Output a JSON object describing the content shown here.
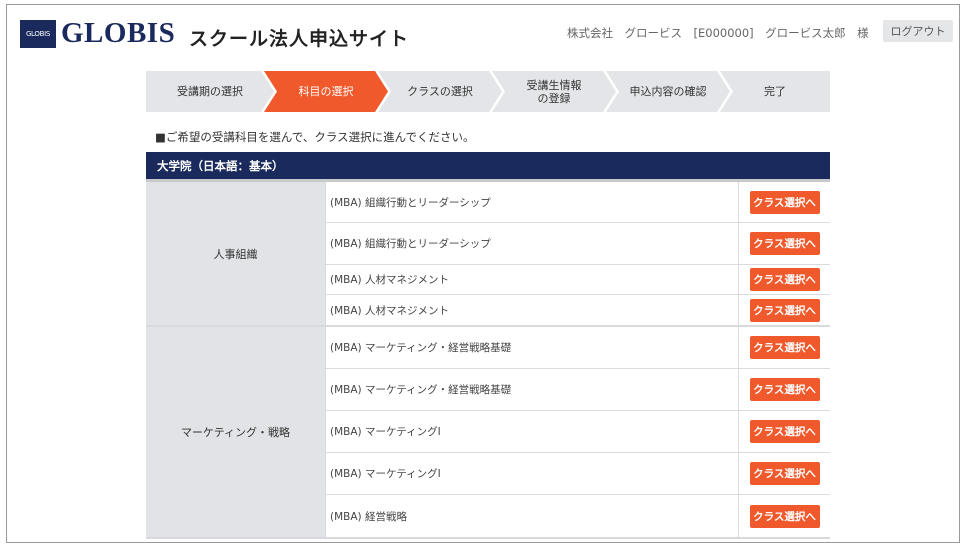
{
  "header": {
    "logo_mark": "GLOBIS",
    "logo_text": "GLOBIS",
    "site_title": "スクール法人申込サイト",
    "user_info": "株式会社　グロービス　[E000000]　グロービス太郎　様",
    "logout_label": "ログアウト"
  },
  "steps": [
    {
      "label": "受講期の選択",
      "active": false
    },
    {
      "label": "科目の選択",
      "active": true
    },
    {
      "label": "クラスの選択",
      "active": false
    },
    {
      "label": "受講生情報\nの登録",
      "active": false
    },
    {
      "label": "申込内容の確認",
      "active": false
    },
    {
      "label": "完了",
      "active": false
    }
  ],
  "instruction": "■ご希望の受講科目を選んで、クラス選択に進んでください。",
  "section": {
    "title": "大学院（日本語：基本）"
  },
  "groups": [
    {
      "category": "人事組織",
      "courses": [
        {
          "name": "(MBA) 組織行動とリーダーシップ",
          "button": "クラス選択へ"
        },
        {
          "name": "(MBA) 組織行動とリーダーシップ",
          "button": "クラス選択へ"
        },
        {
          "name": "(MBA) 人材マネジメント",
          "button": "クラス選択へ"
        },
        {
          "name": "(MBA) 人材マネジメント",
          "button": "クラス選択へ"
        }
      ]
    },
    {
      "category": "マーケティング・戦略",
      "courses": [
        {
          "name": "(MBA) マーケティング・経営戦略基礎",
          "button": "クラス選択へ"
        },
        {
          "name": "(MBA) マーケティング・経営戦略基礎",
          "button": "クラス選択へ"
        },
        {
          "name": "(MBA) マーケティングI",
          "button": "クラス選択へ"
        },
        {
          "name": "(MBA) マーケティングI",
          "button": "クラス選択へ"
        },
        {
          "name": "(MBA) 経営戦略",
          "button": "クラス選択へ"
        }
      ]
    }
  ],
  "colors": {
    "brand_navy": "#1a2a5c",
    "accent_orange": "#f0592b",
    "step_gray": "#e3e5e8"
  }
}
